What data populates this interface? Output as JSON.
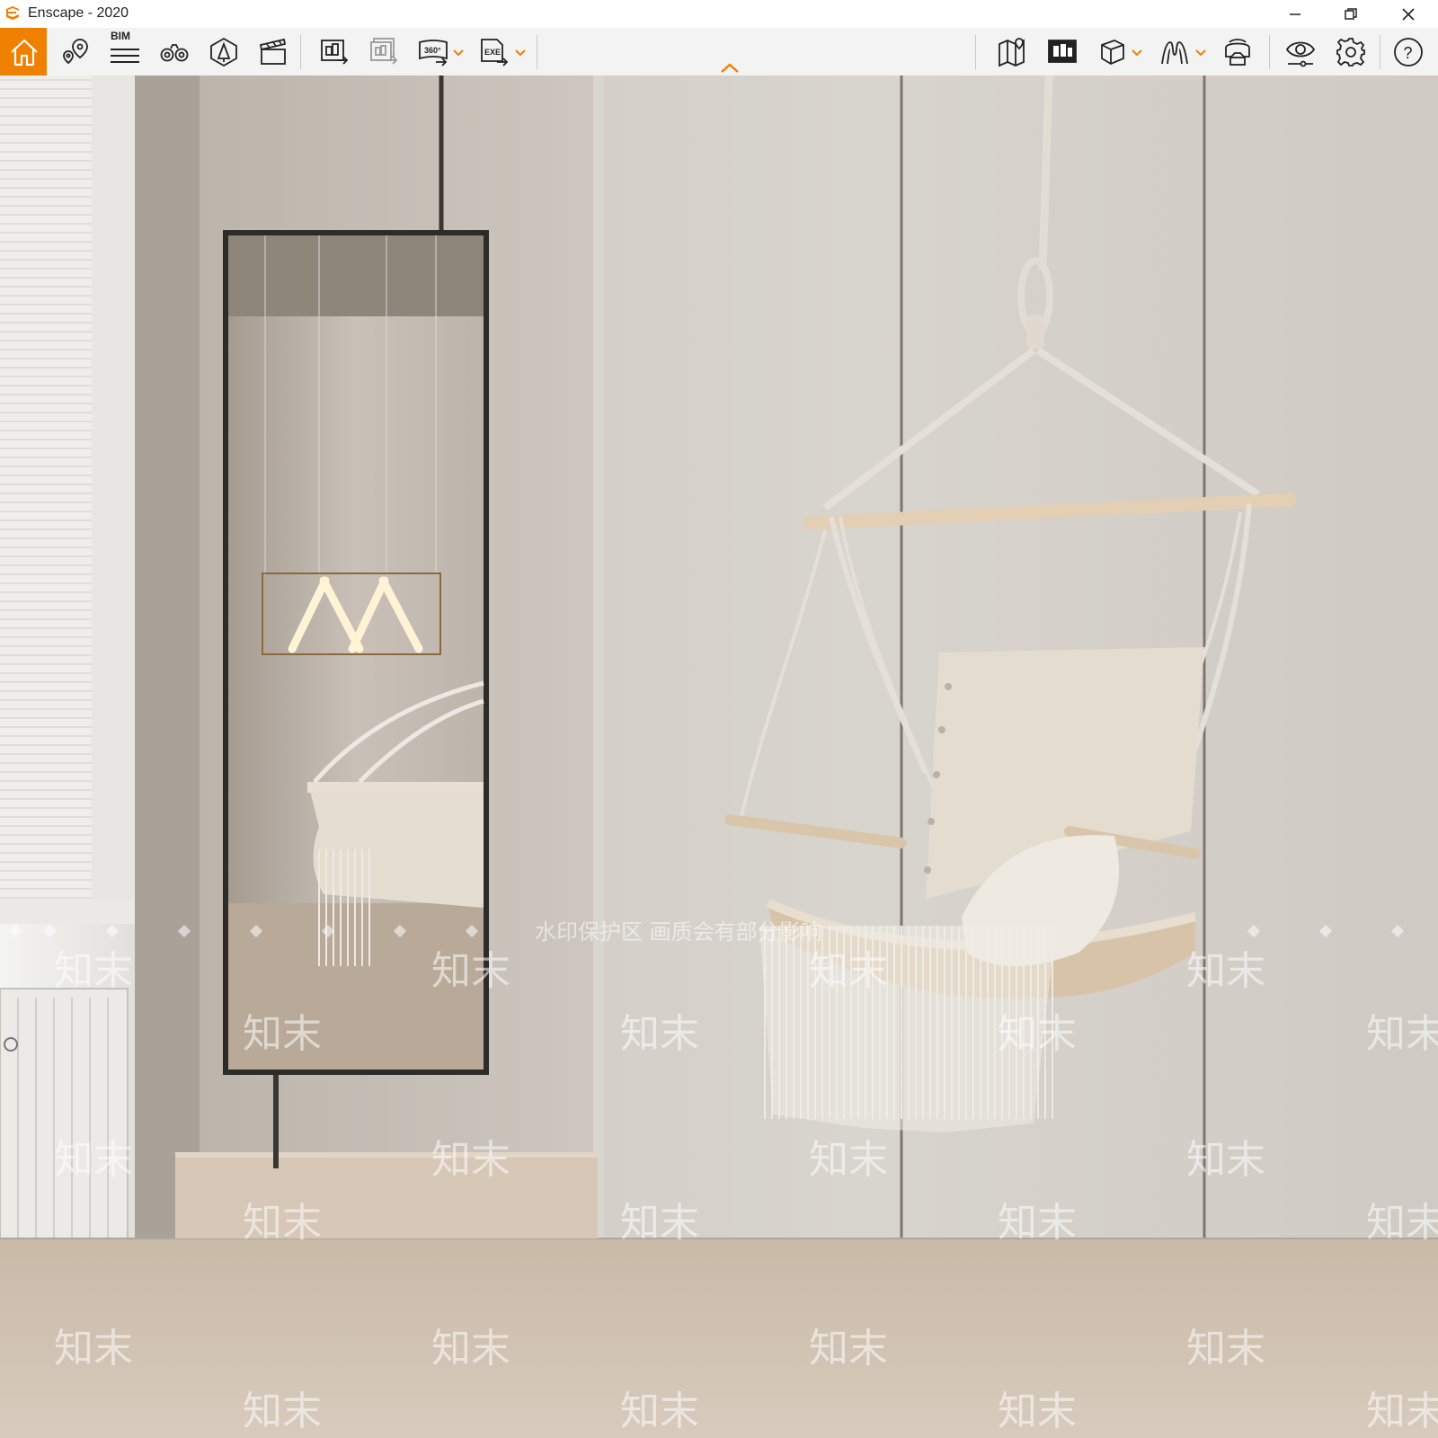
{
  "window": {
    "title": "Enscape - 2020",
    "app_icon": "enscape-logo-icon",
    "accent_color": "#f08000"
  },
  "toolbar": {
    "left_tools": [
      {
        "icon": "home-icon",
        "active": true
      },
      {
        "icon": "location-pins-icon"
      },
      {
        "icon": "bim-icon",
        "label": "BIM"
      },
      {
        "icon": "binoculars-icon"
      },
      {
        "icon": "asset-library-icon"
      },
      {
        "icon": "video-editor-icon"
      },
      {
        "icon": "render-screenshot-icon"
      },
      {
        "icon": "batch-render-icon"
      },
      {
        "icon": "panorama-360-icon",
        "label": "360°"
      },
      {
        "icon": "export-exe-icon",
        "label": "EXE"
      }
    ],
    "right_tools": [
      {
        "icon": "map-icon"
      },
      {
        "icon": "views-icon"
      },
      {
        "icon": "cube-icon"
      },
      {
        "icon": "walk-mode-icon"
      },
      {
        "icon": "vr-headset-icon"
      },
      {
        "icon": "visual-settings-icon"
      },
      {
        "icon": "gear-icon"
      },
      {
        "icon": "help-icon",
        "label": "?"
      }
    ]
  },
  "viewport": {
    "watermark_banner": "水印保护区  画质会有部分影响",
    "watermark_tile": "知末"
  }
}
